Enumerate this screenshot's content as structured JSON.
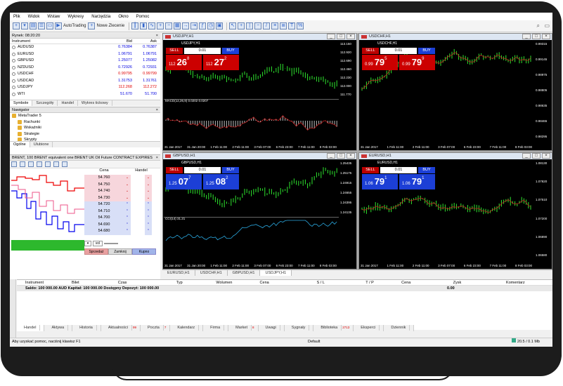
{
  "menu": [
    "Plik",
    "Widok",
    "Wstaw",
    "Wykresy",
    "Narzędzia",
    "Okno",
    "Pomoc"
  ],
  "toolbar": {
    "autotrading": "AutoTrading",
    "new_order": "Nowe Zlecenie"
  },
  "market_watch": {
    "title": "Rynek: 08:20:20",
    "headers": [
      "Instrument",
      "Bid",
      "Ask"
    ],
    "rows": [
      {
        "s": "AUDUSD",
        "b": "0.76384",
        "a": "0.76387",
        "c": "up"
      },
      {
        "s": "EURUSD",
        "b": "1.06791",
        "a": "1.06791",
        "c": "up"
      },
      {
        "s": "GBPUSD",
        "b": "1.25077",
        "a": "1.25082",
        "c": "up"
      },
      {
        "s": "NZDUSD",
        "b": "0.72926",
        "a": "0.72931",
        "c": "up"
      },
      {
        "s": "USDCHF",
        "b": "0.99795",
        "a": "0.99799",
        "c": "dn"
      },
      {
        "s": "USDCAD",
        "b": "1.31753",
        "a": "1.31761",
        "c": "up"
      },
      {
        "s": "USDJPY",
        "b": "112.268",
        "a": "112.272",
        "c": "dn"
      },
      {
        "s": "WTI",
        "b": "51.670",
        "a": "51.700",
        "c": "up"
      }
    ],
    "tabs": [
      "Symbole",
      "Szczegóły",
      "Handel",
      "Wykres tickowy"
    ]
  },
  "navigator": {
    "title": "Nawigator",
    "items": [
      "MetaTrader 5",
      "Rachunki",
      "Wskaźniki",
      "Strategie",
      "Skrypty"
    ],
    "tabs": [
      "Ogólne",
      "Ulubione"
    ]
  },
  "dom": {
    "title": "BRENT, 100 BRENT equivalent one BRENT UK Oil Future CONTRACT EXPIRES",
    "col_price": "Cena",
    "col_trade": "Handel",
    "prices": [
      "54.760",
      "54.750",
      "54.740",
      "54.730",
      "54.720",
      "54.710",
      "54.700",
      "54.690",
      "54.680"
    ],
    "vol": "vol",
    "sell": "Sprzedaż",
    "close": "Zamknij",
    "buy": "Kupno"
  },
  "charts": [
    {
      "title": "USDJPY,H1",
      "sym": "USDJPY,H1",
      "sell": "SELL",
      "buy": "BUY",
      "lot": "0.01",
      "lp": "112",
      "lb": "26",
      "ls": "8",
      "rp": "112",
      "rb": "27",
      "rs": "2",
      "theme": "red",
      "axis": [
        "113.150",
        "112.920",
        "112.690",
        "112.460",
        "112.230",
        "112.000",
        "111.770"
      ],
      "ind": "MACD(12,26,9) 0.0202 0.0207",
      "dates": [
        "31 Jan 2017",
        "31 Jan 20:00",
        "1 Feb 11:00",
        "2 Feb 11:00",
        "3 Feb 07:00",
        "6 Feb 23:00",
        "7 Feb 11:00",
        "8 Feb 03:00"
      ]
    },
    {
      "title": "USDCHF,H1",
      "sym": "USDCHF,H1",
      "sell": "SELL",
      "buy": "BUY",
      "lot": "0.01",
      "lp": "0.99",
      "lb": "79",
      "ls": "5",
      "rp": "0.99",
      "rb": "79",
      "rs": "9",
      "theme": "red",
      "axis": [
        "0.99315",
        "0.99145",
        "0.98975",
        "0.98805",
        "0.98635",
        "0.98465",
        "0.98295"
      ],
      "ind": "",
      "dates": [
        "31 Jan 2017",
        "1 Feb 11:00",
        "2 Feb 11:00",
        "3 Feb 07:00",
        "6 Feb 23:00",
        "7 Feb 11:00",
        "8 Feb 03:00"
      ]
    },
    {
      "title": "GBPUSD,H1",
      "sym": "GBPUSD,H1",
      "sell": "SELL",
      "buy": "BUY",
      "lot": "0.01",
      "lp": "1.25",
      "lb": "07",
      "ls": "7",
      "rp": "1.25",
      "rb": "08",
      "rs": "2",
      "theme": "blue",
      "axis": [
        "1.25435",
        "1.25175",
        "1.24915",
        "1.24655",
        "1.24395",
        "1.24135"
      ],
      "ind": "CCI(14) 31.21",
      "dates": [
        "31 Jan 2017",
        "31 Jan 20:00",
        "1 Feb 11:00",
        "2 Feb 11:00",
        "3 Feb 07:00",
        "6 Feb 23:00",
        "7 Feb 11:00",
        "8 Feb 03:00"
      ]
    },
    {
      "title": "EURUSD,H1",
      "sym": "EURUSD,H1",
      "sell": "SELL",
      "buy": "BUY",
      "lot": "0.01",
      "lp": "1.06",
      "lb": "79",
      "ls": "1",
      "rp": "1.06",
      "rb": "79",
      "rs": "1",
      "theme": "blue",
      "axis": [
        "1.08130",
        "1.07820",
        "1.07510",
        "1.07200",
        "1.06890",
        "1.06580"
      ],
      "ind": "",
      "dates": [
        "31 Jan 2017",
        "1 Feb 11:00",
        "2 Feb 11:00",
        "3 Feb 07:00",
        "6 Feb 23:00",
        "7 Feb 11:00",
        "8 Feb 03:00"
      ]
    }
  ],
  "chart_tabs": [
    "EURUSD,H1",
    "USDCHF,H1",
    "GBPUSD,H1",
    "USDJPY,H1"
  ],
  "terminal": {
    "headers": [
      "Instrument",
      "Bilet",
      "Czas",
      "Typ",
      "Wolumen",
      "Cena",
      "S / L",
      "T / P",
      "Cena",
      "Zysk",
      "Komentarz"
    ],
    "balance": "Saldo: 100 000.00 AUD  Kapitał: 100 000.00  Dostępny Depozyt: 100 000.00",
    "profit": "0.00",
    "tabs": [
      {
        "l": "Handel"
      },
      {
        "l": "Aktywa"
      },
      {
        "l": "Historia"
      },
      {
        "l": "Aktualności",
        "n": "99"
      },
      {
        "l": "Poczta",
        "n": "7"
      },
      {
        "l": "Kalendarz"
      },
      {
        "l": "Firma"
      },
      {
        "l": "Market",
        "n": "8"
      },
      {
        "l": "Uwagi"
      },
      {
        "l": "Sygnały"
      },
      {
        "l": "Biblioteka",
        "n": "2713"
      },
      {
        "l": "Eksperci"
      },
      {
        "l": "Dziennik"
      }
    ]
  },
  "status": {
    "help": "Aby uzyskać pomoc, naciśnij klawisz F1",
    "profile": "Default",
    "traffic": "20.5 / 0.1 Mb"
  }
}
